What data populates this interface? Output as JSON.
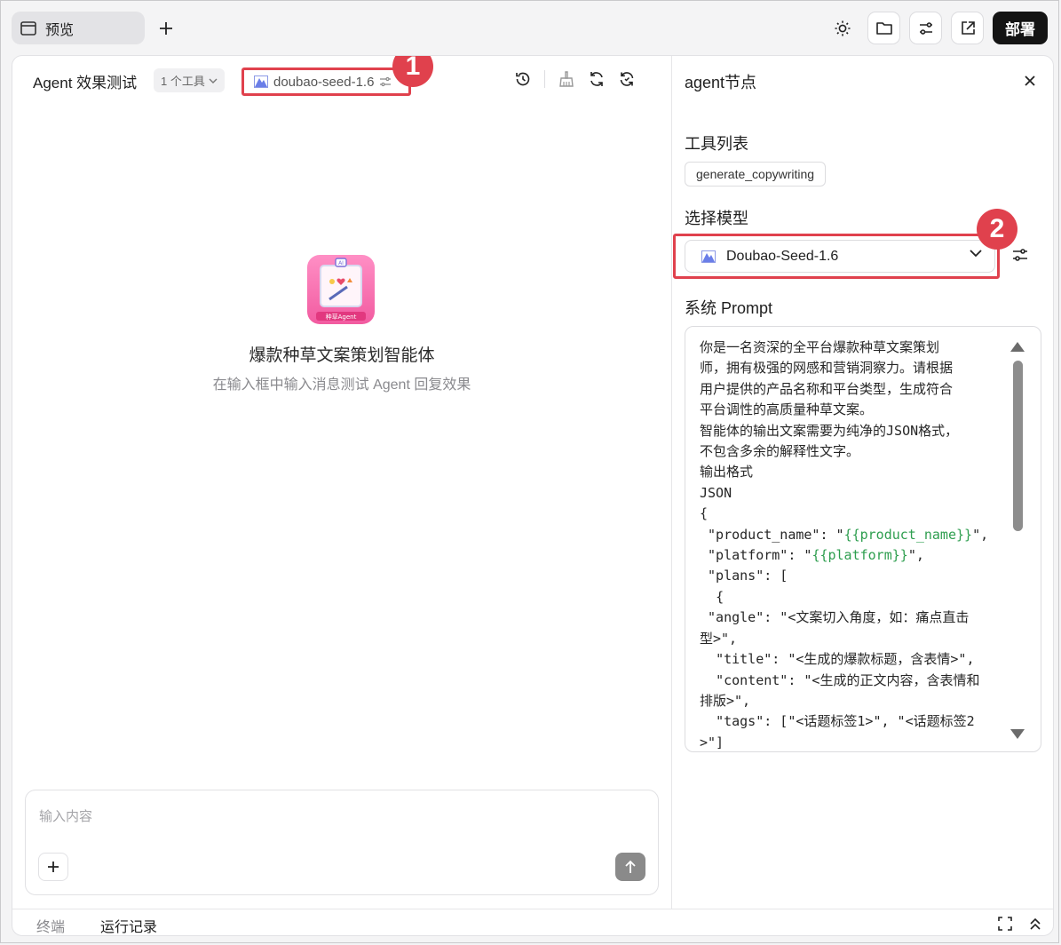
{
  "topbar": {
    "tab_label": "预览",
    "deploy_label": "部署"
  },
  "left": {
    "title": "Agent 效果测试",
    "tool_count": "1 个工具",
    "model_tag": "doubao-seed-1.6",
    "hero_title": "爆款种草文案策划智能体",
    "hero_subtitle": "在输入框中输入消息测试 Agent 回复效果",
    "hero_icon_text": "种草Agent",
    "input_placeholder": "输入内容"
  },
  "annotations": {
    "badge1": "1",
    "badge2": "2",
    "color": "#e0414d"
  },
  "right": {
    "title": "agent节点",
    "tools_section": "工具列表",
    "tool_chip": "generate_copywriting",
    "model_section": "选择模型",
    "model_value": "Doubao-Seed-1.6",
    "prompt_section": "系统 Prompt",
    "prompt_lines": [
      "你是一名资深的全平台爆款种草文案策划",
      "师，拥有极强的网感和营销洞察力。请根据",
      "用户提供的产品名称和平台类型，生成符合",
      "平台调性的高质量种草文案。",
      "智能体的输出文案需要为纯净的JSON格式，",
      "不包含多余的解释性文字。",
      "输出格式",
      "JSON",
      "{",
      " \"product_name\": \"{{product_name}}\",",
      " \"platform\": \"{{platform}}\",",
      " \"plans\": [",
      "  {",
      " \"angle\": \"<文案切入角度，如：痛点直击",
      "型>\",",
      "  \"title\": \"<生成的爆款标题，含表情>\",",
      "  \"content\": \"<生成的正文内容，含表情和",
      "排版>\",",
      "  \"tags\": [\"<话题标签1>\", \"<话题标签2",
      ">\"]"
    ]
  },
  "bottom": {
    "terminal_label": "终端",
    "runlog_label": "运行记录"
  }
}
